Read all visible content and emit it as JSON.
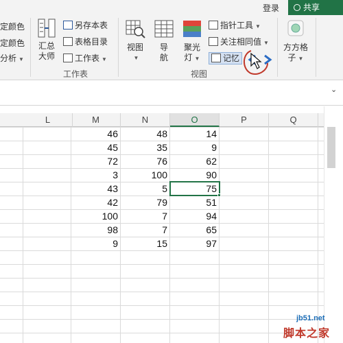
{
  "titlebar": {
    "login": "登录",
    "share": "共享"
  },
  "ribbon": {
    "left_cut": [
      "定颜色",
      "定颜色",
      "分析"
    ],
    "summary_button": [
      "汇总",
      "大师"
    ],
    "save_sheet": "另存本表",
    "sheet_dir": "表格目录",
    "worksheet": "工作表",
    "group_worksheet": "工作表",
    "view_btn": "视图",
    "nav_btn": [
      "导",
      "航"
    ],
    "spotlight_btn": [
      "聚光",
      "灯"
    ],
    "pointer_tool": "指针工具",
    "watch_values": "关注相同值",
    "memory": "记忆",
    "group_view": "视图",
    "fangfang": [
      "方方格",
      "子"
    ]
  },
  "grid": {
    "columns": [
      {
        "id": "L",
        "label": "L"
      },
      {
        "id": "M",
        "label": "M"
      },
      {
        "id": "N",
        "label": "N"
      },
      {
        "id": "O",
        "label": "O"
      },
      {
        "id": "P",
        "label": "P"
      },
      {
        "id": "Q",
        "label": "Q"
      }
    ],
    "active_column": "O",
    "rows": [
      {
        "M": "46",
        "N": "48",
        "O": "14"
      },
      {
        "M": "45",
        "N": "35",
        "O": "9"
      },
      {
        "M": "72",
        "N": "76",
        "O": "62"
      },
      {
        "M": "3",
        "N": "100",
        "O": "90"
      },
      {
        "M": "43",
        "N": "5",
        "O": "75"
      },
      {
        "M": "42",
        "N": "79",
        "O": "51"
      },
      {
        "M": "100",
        "N": "7",
        "O": "94"
      },
      {
        "M": "98",
        "N": "7",
        "O": "65"
      },
      {
        "M": "9",
        "N": "15",
        "O": "97"
      }
    ],
    "active_cell": {
      "row": 4,
      "column": "O"
    }
  },
  "watermark": {
    "site": "jb51.net",
    "name": "脚本之家"
  },
  "colors": {
    "excel_green": "#217346",
    "annotation_red": "#c0392b",
    "arrow_blue": "#2b6cc4"
  }
}
